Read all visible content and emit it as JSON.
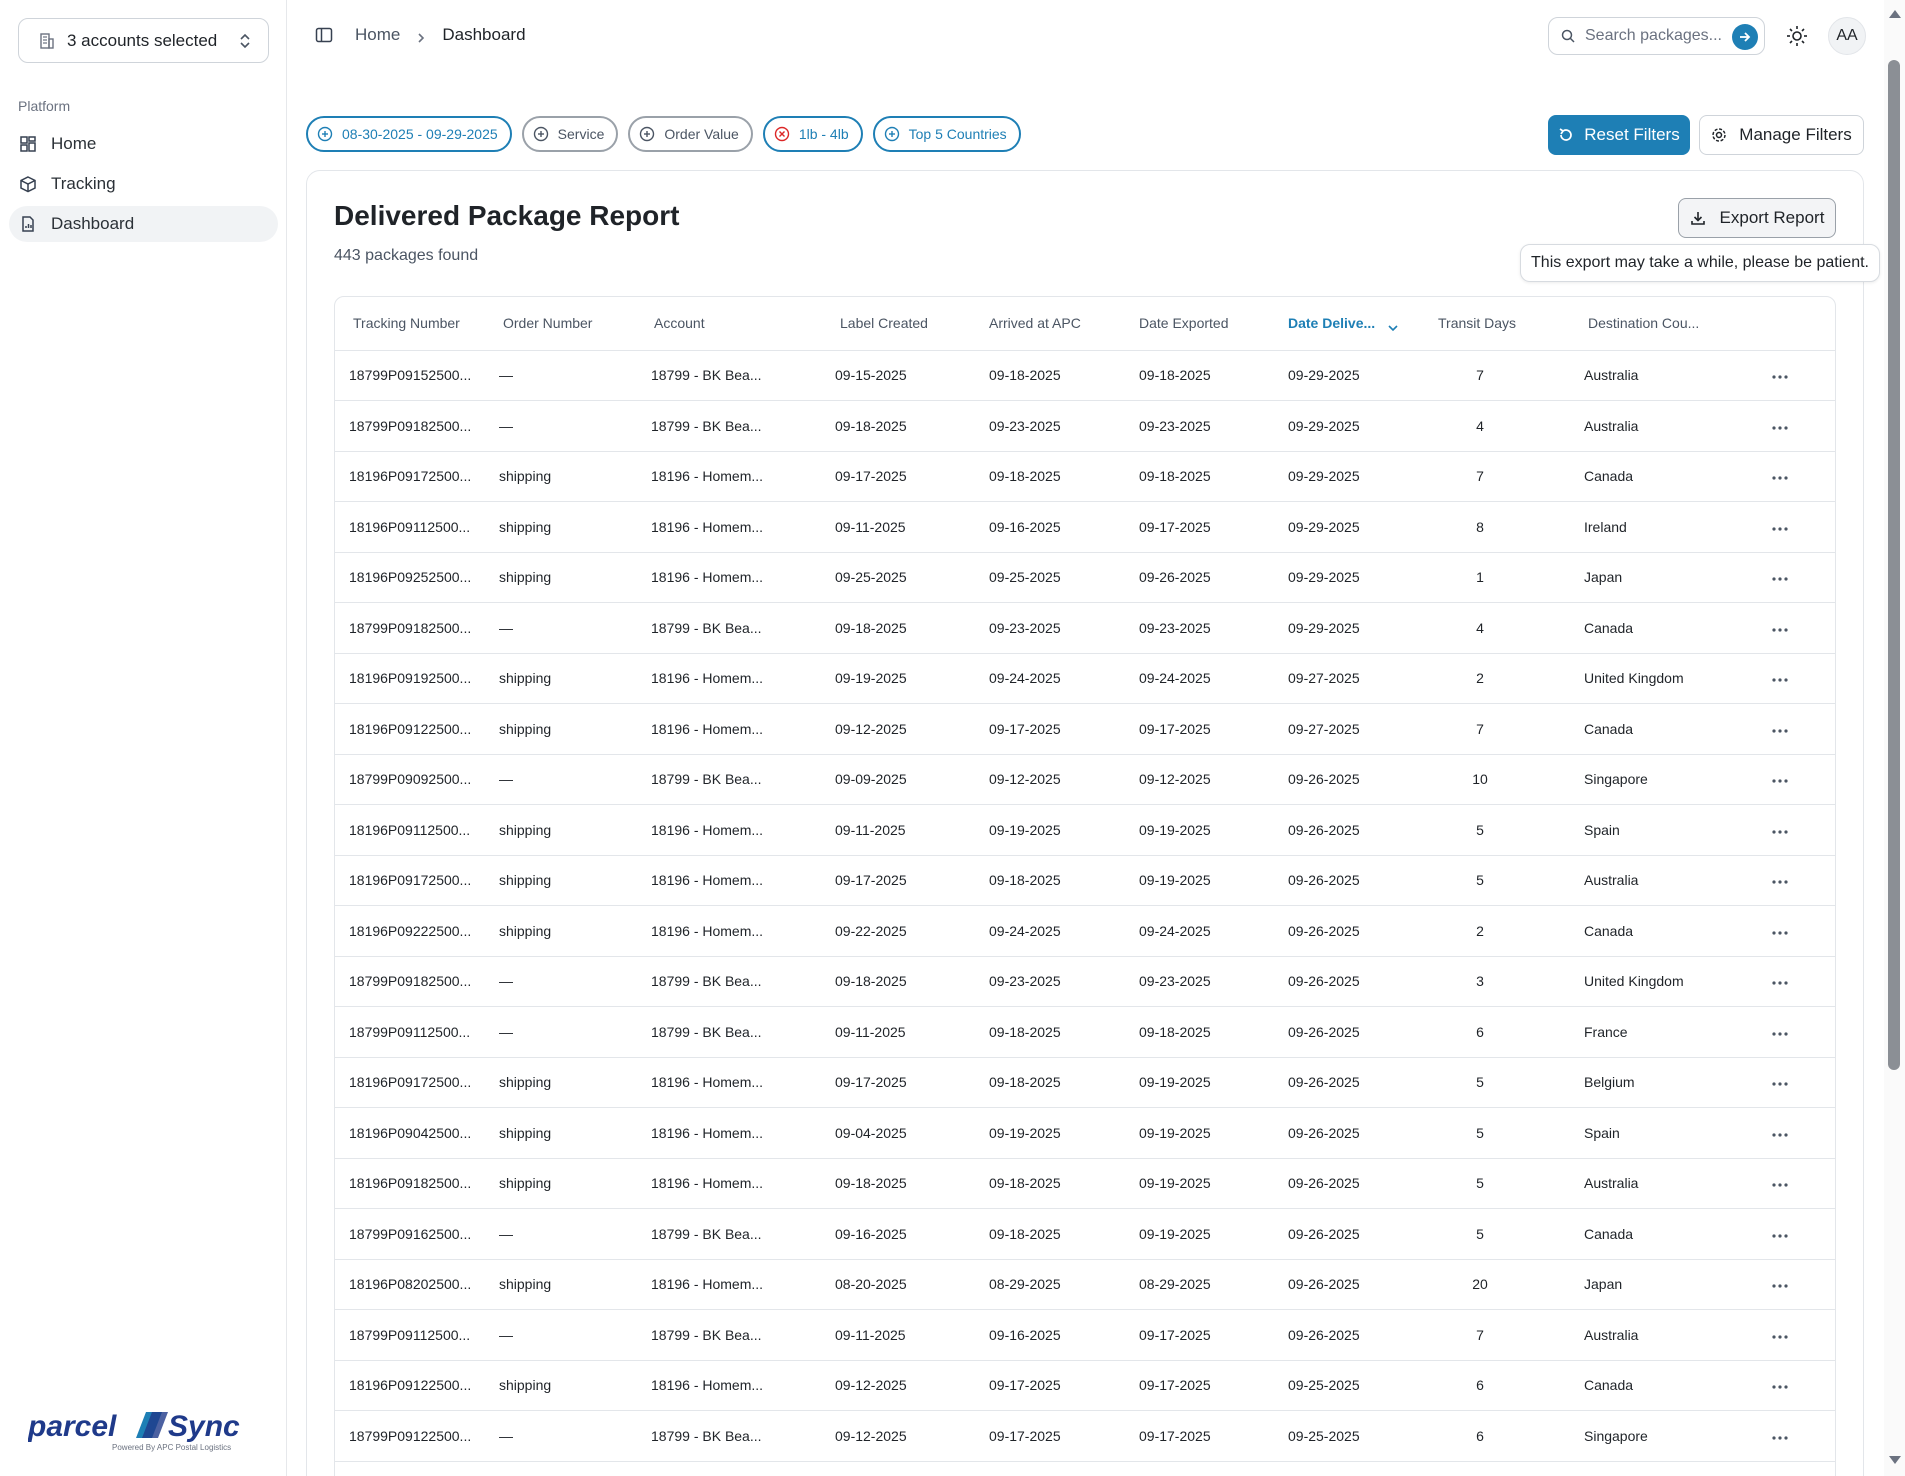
{
  "sidebar": {
    "account_selector": "3 accounts selected",
    "section_label": "Platform",
    "items": [
      {
        "label": "Home",
        "icon": "grid-icon"
      },
      {
        "label": "Tracking",
        "icon": "package-icon"
      },
      {
        "label": "Dashboard",
        "icon": "report-icon",
        "active": true
      }
    ],
    "brand": {
      "name": "parcelSync",
      "tagline": "Powered By APC Postal Logistics"
    }
  },
  "header": {
    "breadcrumb": {
      "home": "Home",
      "current": "Dashboard"
    },
    "search_placeholder": "Search packages...",
    "avatar_initials": "AA"
  },
  "filters": {
    "chips": [
      {
        "label": "08-30-2025 - 09-29-2025",
        "style": "blue",
        "icon": "plus-circle-icon"
      },
      {
        "label": "Service",
        "style": "grey",
        "icon": "plus-circle-icon"
      },
      {
        "label": "Order Value",
        "style": "grey",
        "icon": "plus-circle-icon"
      },
      {
        "label": "1lb - 4lb",
        "style": "blue",
        "icon": "x-circle-icon"
      },
      {
        "label": "Top 5 Countries",
        "style": "blue",
        "icon": "plus-circle-icon"
      }
    ],
    "reset_label": "Reset Filters",
    "manage_label": "Manage Filters"
  },
  "report": {
    "title": "Delivered Package Report",
    "count_text": "443 packages found",
    "export_label": "Export Report",
    "export_tooltip": "This export may take a while, please be patient."
  },
  "table": {
    "columns": [
      "Tracking Number",
      "Order Number",
      "Account",
      "Label Created",
      "Arrived at APC",
      "Date Exported",
      "Date Delive...",
      "Transit Days",
      "Destination Cou..."
    ],
    "sorted_column": "Date Delive...",
    "rows": [
      [
        "18799P09152500...",
        "—",
        "18799 - BK Bea...",
        "09-15-2025",
        "09-18-2025",
        "09-18-2025",
        "09-29-2025",
        "7",
        "Australia"
      ],
      [
        "18799P09182500...",
        "—",
        "18799 - BK Bea...",
        "09-18-2025",
        "09-23-2025",
        "09-23-2025",
        "09-29-2025",
        "4",
        "Australia"
      ],
      [
        "18196P09172500...",
        "shipping",
        "18196 - Homem...",
        "09-17-2025",
        "09-18-2025",
        "09-18-2025",
        "09-29-2025",
        "7",
        "Canada"
      ],
      [
        "18196P09112500...",
        "shipping",
        "18196 - Homem...",
        "09-11-2025",
        "09-16-2025",
        "09-17-2025",
        "09-29-2025",
        "8",
        "Ireland"
      ],
      [
        "18196P09252500...",
        "shipping",
        "18196 - Homem...",
        "09-25-2025",
        "09-25-2025",
        "09-26-2025",
        "09-29-2025",
        "1",
        "Japan"
      ],
      [
        "18799P09182500...",
        "—",
        "18799 - BK Bea...",
        "09-18-2025",
        "09-23-2025",
        "09-23-2025",
        "09-29-2025",
        "4",
        "Canada"
      ],
      [
        "18196P09192500...",
        "shipping",
        "18196 - Homem...",
        "09-19-2025",
        "09-24-2025",
        "09-24-2025",
        "09-27-2025",
        "2",
        "United Kingdom"
      ],
      [
        "18196P09122500...",
        "shipping",
        "18196 - Homem...",
        "09-12-2025",
        "09-17-2025",
        "09-17-2025",
        "09-27-2025",
        "7",
        "Canada"
      ],
      [
        "18799P09092500...",
        "—",
        "18799 - BK Bea...",
        "09-09-2025",
        "09-12-2025",
        "09-12-2025",
        "09-26-2025",
        "10",
        "Singapore"
      ],
      [
        "18196P09112500...",
        "shipping",
        "18196 - Homem...",
        "09-11-2025",
        "09-19-2025",
        "09-19-2025",
        "09-26-2025",
        "5",
        "Spain"
      ],
      [
        "18196P09172500...",
        "shipping",
        "18196 - Homem...",
        "09-17-2025",
        "09-18-2025",
        "09-19-2025",
        "09-26-2025",
        "5",
        "Australia"
      ],
      [
        "18196P09222500...",
        "shipping",
        "18196 - Homem...",
        "09-22-2025",
        "09-24-2025",
        "09-24-2025",
        "09-26-2025",
        "2",
        "Canada"
      ],
      [
        "18799P09182500...",
        "—",
        "18799 - BK Bea...",
        "09-18-2025",
        "09-23-2025",
        "09-23-2025",
        "09-26-2025",
        "3",
        "United Kingdom"
      ],
      [
        "18799P09112500...",
        "—",
        "18799 - BK Bea...",
        "09-11-2025",
        "09-18-2025",
        "09-18-2025",
        "09-26-2025",
        "6",
        "France"
      ],
      [
        "18196P09172500...",
        "shipping",
        "18196 - Homem...",
        "09-17-2025",
        "09-18-2025",
        "09-19-2025",
        "09-26-2025",
        "5",
        "Belgium"
      ],
      [
        "18196P09042500...",
        "shipping",
        "18196 - Homem...",
        "09-04-2025",
        "09-19-2025",
        "09-19-2025",
        "09-26-2025",
        "5",
        "Spain"
      ],
      [
        "18196P09182500...",
        "shipping",
        "18196 - Homem...",
        "09-18-2025",
        "09-18-2025",
        "09-19-2025",
        "09-26-2025",
        "5",
        "Australia"
      ],
      [
        "18799P09162500...",
        "—",
        "18799 - BK Bea...",
        "09-16-2025",
        "09-18-2025",
        "09-19-2025",
        "09-26-2025",
        "5",
        "Canada"
      ],
      [
        "18196P08202500...",
        "shipping",
        "18196 - Homem...",
        "08-20-2025",
        "08-29-2025",
        "08-29-2025",
        "09-26-2025",
        "20",
        "Japan"
      ],
      [
        "18799P09112500...",
        "—",
        "18799 - BK Bea...",
        "09-11-2025",
        "09-16-2025",
        "09-17-2025",
        "09-26-2025",
        "7",
        "Australia"
      ],
      [
        "18196P09122500...",
        "shipping",
        "18196 - Homem...",
        "09-12-2025",
        "09-17-2025",
        "09-17-2025",
        "09-25-2025",
        "6",
        "Canada"
      ],
      [
        "18799P09122500...",
        "—",
        "18799 - BK Bea...",
        "09-12-2025",
        "09-17-2025",
        "09-17-2025",
        "09-25-2025",
        "6",
        "Singapore"
      ]
    ]
  },
  "colors": {
    "accent": "#1e7fb5",
    "border": "#e3e6ea",
    "muted": "#4b5563"
  }
}
